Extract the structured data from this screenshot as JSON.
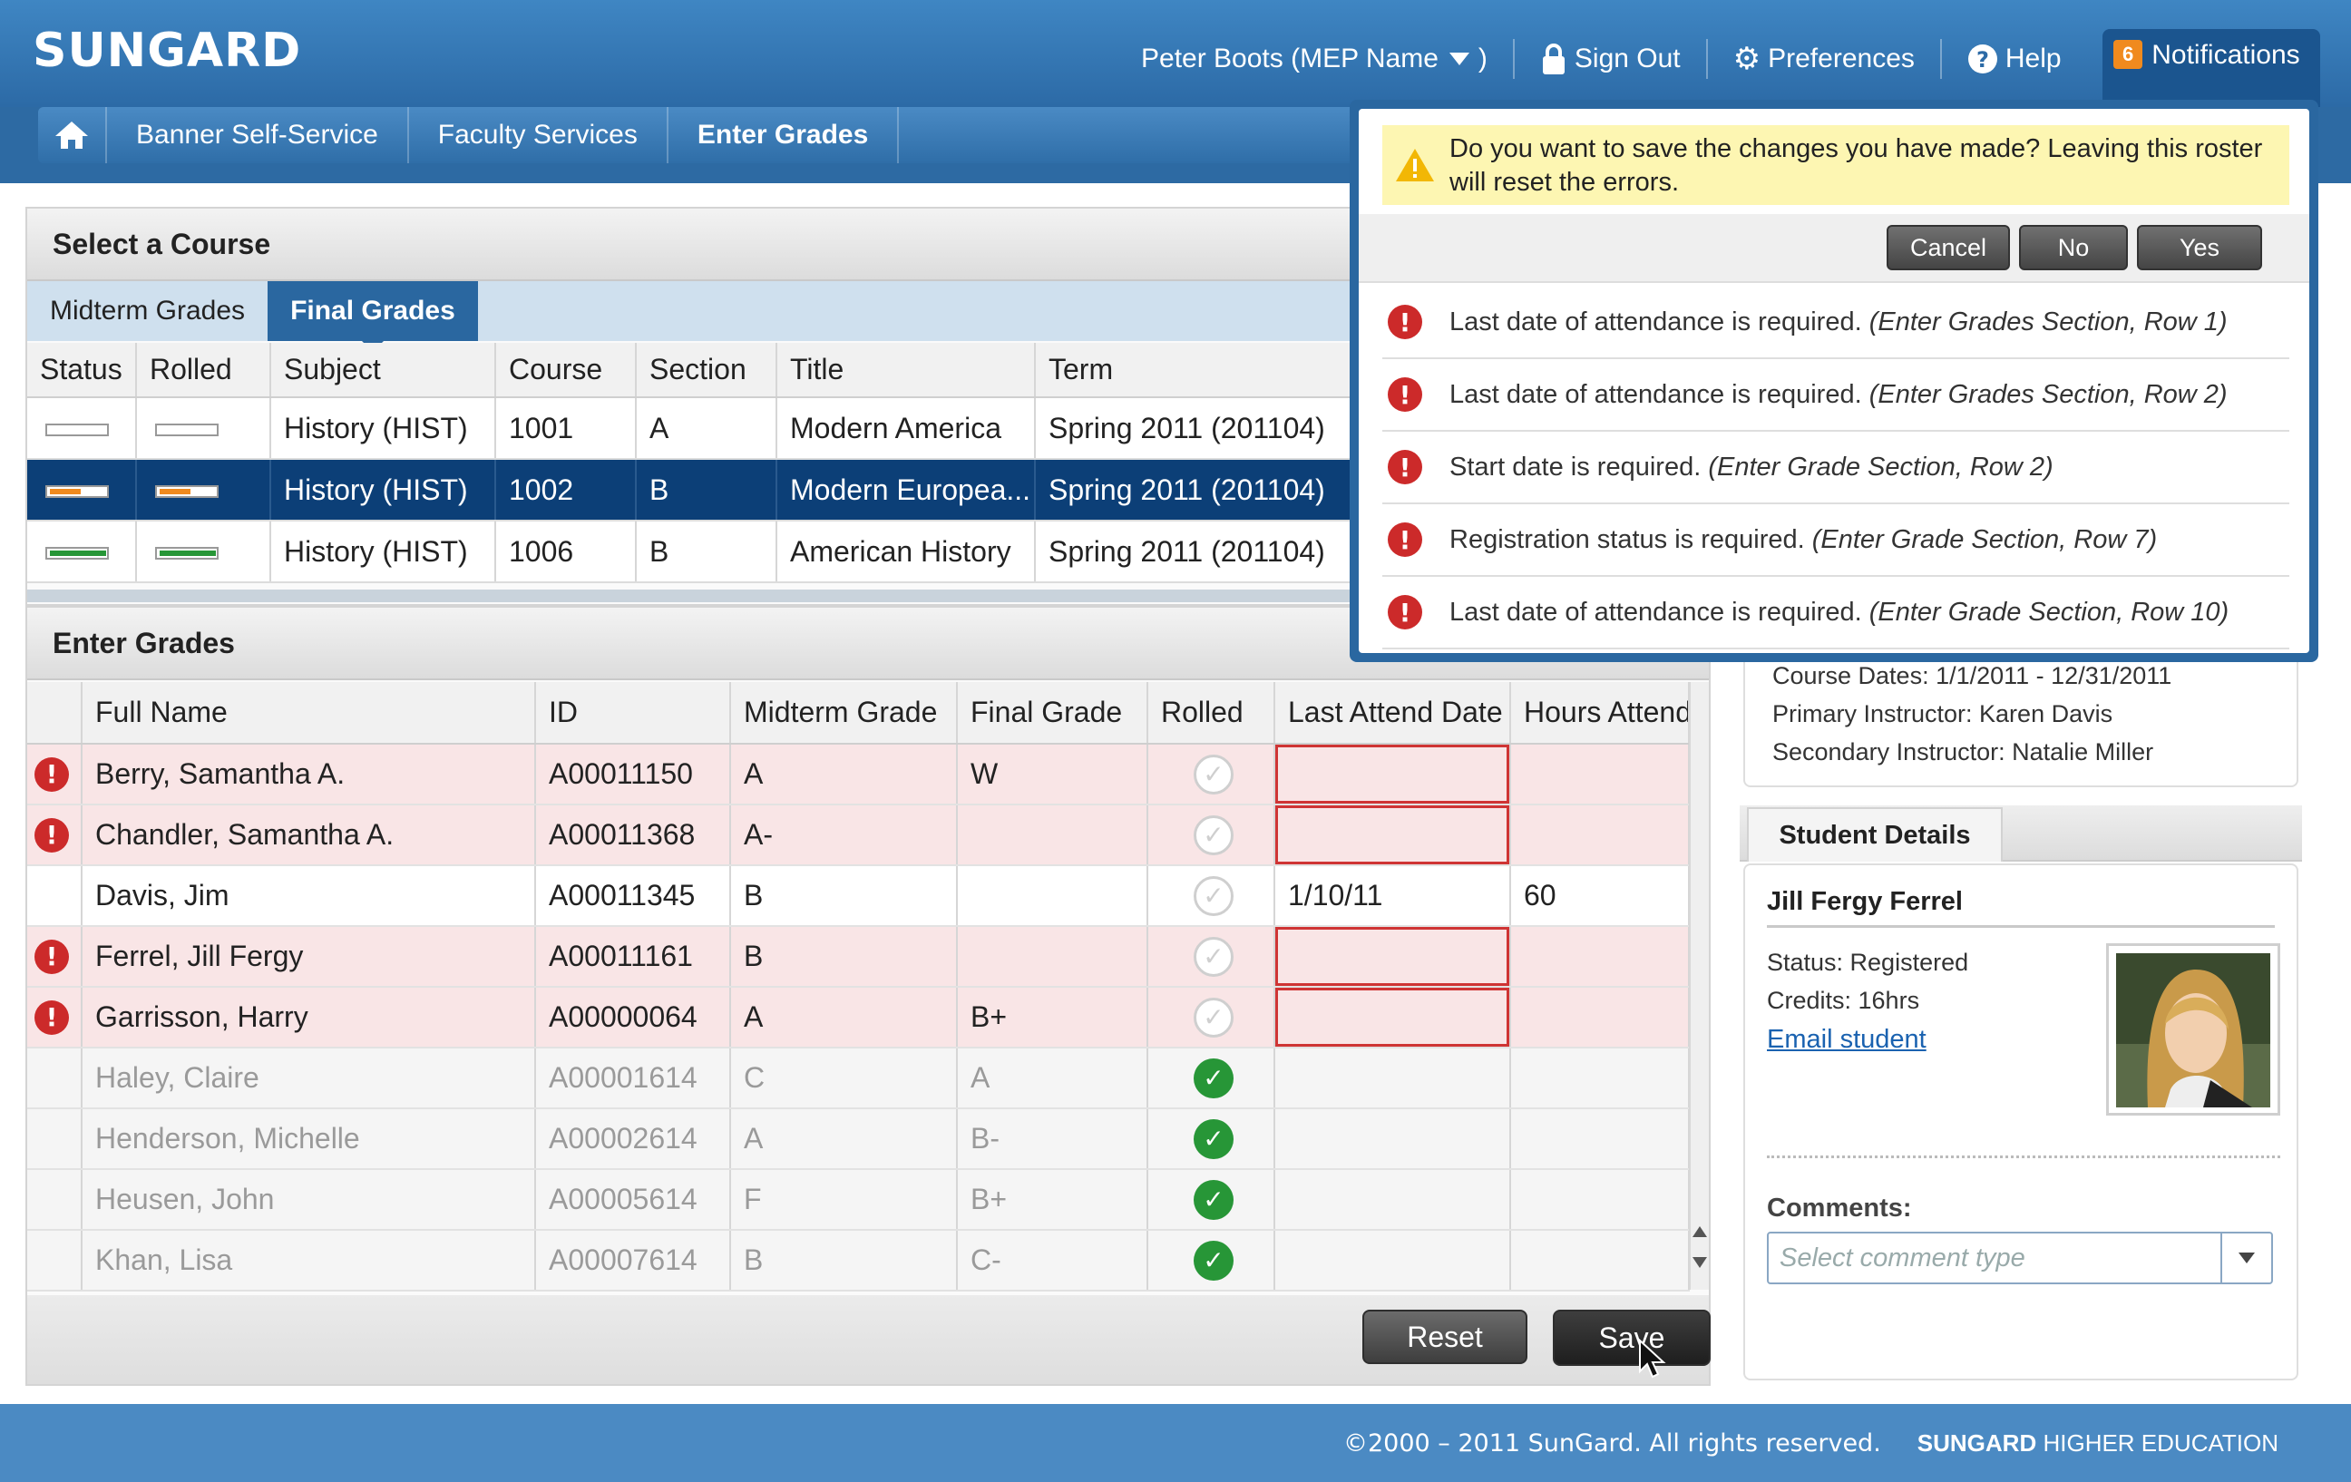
{
  "brand": {
    "logo": "SUNGARD"
  },
  "topnav": {
    "user": "Peter Boots (MEP Name",
    "user_suffix": ")",
    "sign_out": "Sign Out",
    "preferences": "Preferences",
    "help": "Help",
    "notifications_count": "6",
    "notifications": "Notifications"
  },
  "breadcrumb": [
    "Banner Self-Service",
    "Faculty Services",
    "Enter Grades"
  ],
  "course": {
    "title": "Select a Course",
    "tabs": [
      "Midterm Grades",
      "Final Grades"
    ],
    "columns": [
      "Status",
      "Rolled",
      "Subject",
      "Course",
      "Section",
      "Title",
      "Term"
    ],
    "rows": [
      {
        "status": {
          "color": "#ffffff",
          "fraction": 0
        },
        "rolled": {
          "color": "#ffffff",
          "fraction": 0
        },
        "subject": "History (HIST)",
        "course": "1001",
        "section": "A",
        "title": "Modern America",
        "term": "Spring 2011 (201104)"
      },
      {
        "status": {
          "color": "#f08a1e",
          "fraction": 0.55
        },
        "rolled": {
          "color": "#f08a1e",
          "fraction": 0.55
        },
        "subject": "History (HIST)",
        "course": "1002",
        "section": "B",
        "title": "Modern Europea...",
        "term": "Spring 2011 (201104)"
      },
      {
        "status": {
          "color": "#279637",
          "fraction": 1
        },
        "rolled": {
          "color": "#279637",
          "fraction": 1
        },
        "subject": "History (HIST)",
        "course": "1006",
        "section": "B",
        "title": "American History",
        "term": "Spring 2011 (201104)"
      }
    ]
  },
  "grades": {
    "title": "Enter Grades",
    "columns": [
      "Full Name",
      "ID",
      "Midterm Grade",
      "Final Grade",
      "Rolled",
      "Last Attend Date",
      "Hours Attend"
    ],
    "rows": [
      {
        "error": true,
        "name": "Berry, Samantha A.",
        "id": "A00011150",
        "midterm": "A",
        "final": "W",
        "rolled": false,
        "attend": "",
        "hours": ""
      },
      {
        "error": true,
        "name": "Chandler, Samantha A.",
        "id": "A00011368",
        "midterm": "A-",
        "final": "",
        "rolled": false,
        "attend": "",
        "hours": ""
      },
      {
        "error": false,
        "name": "Davis, Jim",
        "id": "A00011345",
        "midterm": "B",
        "final": "",
        "rolled": false,
        "attend": "1/10/11",
        "hours": "60"
      },
      {
        "error": true,
        "name": "Ferrel, Jill Fergy",
        "id": "A00011161",
        "midterm": "B",
        "final": "",
        "rolled": false,
        "attend": "",
        "hours": ""
      },
      {
        "error": true,
        "name": "Garrisson, Harry",
        "id": "A00000064",
        "midterm": "A",
        "final": "B+",
        "rolled": false,
        "attend": "",
        "hours": ""
      },
      {
        "error": false,
        "done": true,
        "name": "Haley, Claire",
        "id": "A00001614",
        "midterm": "C",
        "final": "A",
        "rolled": true,
        "attend": "",
        "hours": ""
      },
      {
        "error": false,
        "done": true,
        "name": "Henderson, Michelle",
        "id": "A00002614",
        "midterm": "A",
        "final": "B-",
        "rolled": true,
        "attend": "",
        "hours": ""
      },
      {
        "error": false,
        "done": true,
        "name": "Heusen, John",
        "id": "A00005614",
        "midterm": "F",
        "final": "B+",
        "rolled": true,
        "attend": "",
        "hours": ""
      },
      {
        "error": false,
        "done": true,
        "name": "Khan, Lisa",
        "id": "A00007614",
        "midterm": "B",
        "final": "C-",
        "rolled": true,
        "attend": "",
        "hours": ""
      }
    ],
    "reset": "Reset",
    "save": "Save"
  },
  "course_info": {
    "dates": "Course Dates: 1/1/2011 - 12/31/2011",
    "primary": "Primary Instructor: Karen Davis",
    "secondary": "Secondary Instructor: Natalie Miller"
  },
  "student": {
    "tab": "Student Details",
    "name": "Jill Fergy Ferrel",
    "status": "Status: Registered",
    "credits": "Credits: 16hrs",
    "email": "Email student",
    "comments_label": "Comments:",
    "comment_placeholder": "Select comment type"
  },
  "notification_panel": {
    "warning": "Do you want to save the changes you have made? Leaving this roster will reset the errors.",
    "cancel": "Cancel",
    "no": "No",
    "yes": "Yes",
    "errors": [
      {
        "msg": "Last date of attendance is required.",
        "loc": "(Enter Grades Section, Row 1)"
      },
      {
        "msg": "Last date of attendance is required.",
        "loc": "(Enter Grades Section, Row 2)"
      },
      {
        "msg": "Start date is required.",
        "loc": "(Enter Grade Section, Row 2)"
      },
      {
        "msg": "Registration status is required.",
        "loc": "(Enter Grade Section, Row 7)"
      },
      {
        "msg": "Last date of attendance is required.",
        "loc": "(Enter Grade Section, Row 10)"
      }
    ]
  },
  "footer": {
    "copyright": "©2000 – 2011 SunGard. All rights reserved.",
    "brand": "SUNGARD",
    "brand_suffix": "HIGHER EDUCATION"
  }
}
